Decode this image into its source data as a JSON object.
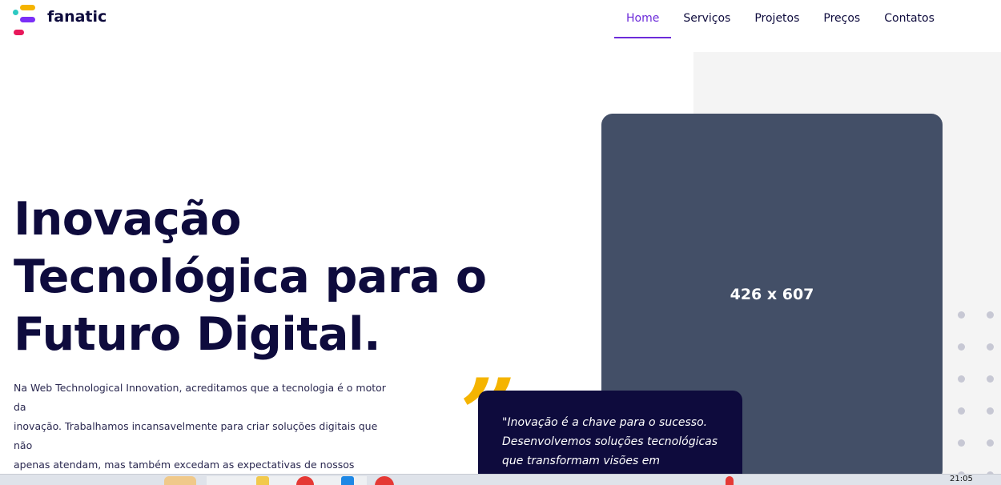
{
  "header": {
    "brand": "fanatic",
    "nav": [
      {
        "label": "Home",
        "active": true
      },
      {
        "label": "Serviços",
        "active": false
      },
      {
        "label": "Projetos",
        "active": false
      },
      {
        "label": "Preços",
        "active": false
      },
      {
        "label": "Contatos",
        "active": false
      }
    ]
  },
  "hero": {
    "title_line1": "Inovação",
    "title_line2": "Tecnológica para o",
    "title_line3": "Futuro Digital.",
    "text_line1": "Na Web Technological Innovation, acreditamos que a tecnologia é o motor da",
    "text_line2": "inovação. Trabalhamos incansavelmente para criar soluções digitais que não",
    "text_line3": "apenas atendam, mas também excedam as expectativas de nossos clientes."
  },
  "image_placeholder": {
    "label": "426 x 607"
  },
  "quote": {
    "mark": "”",
    "line1": "\"Inovação é a chave para o sucesso.",
    "line2": "Desenvolvemos soluções tecnológicas",
    "line3": "que transformam visões em realidade,"
  },
  "taskbar": {
    "clock": "21:05"
  },
  "colors": {
    "brand_dark": "#0e0b3d",
    "accent": "#6c2bd9",
    "quote_yellow": "#f5b400",
    "placeholder_bg": "#434f67"
  }
}
